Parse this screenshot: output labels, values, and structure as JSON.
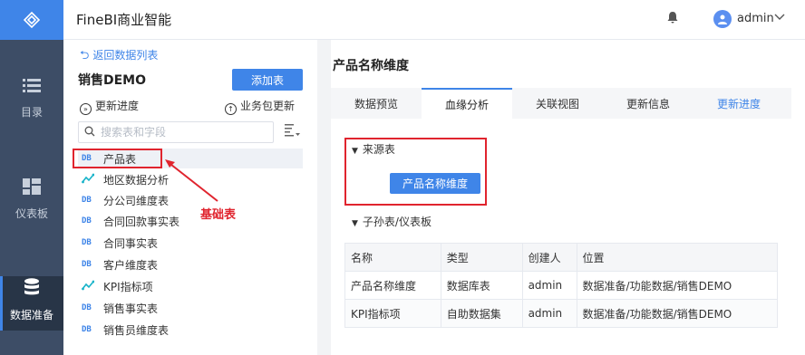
{
  "nav": {
    "items": [
      {
        "label": "目录",
        "icon": "list-icon"
      },
      {
        "label": "仪表板",
        "icon": "dashboard-icon"
      },
      {
        "label": "数据准备",
        "icon": "database-icon"
      }
    ]
  },
  "topbar": {
    "app_title": "FineBI商业智能",
    "username": "admin",
    "avatar": "👤"
  },
  "mid": {
    "back_link": "返回数据列表",
    "package_name": "销售DEMO",
    "add_table_button": "添加表",
    "update_progress": "更新进度",
    "business_update": "业务包更新",
    "search_placeholder": "搜索表和字段",
    "tables": [
      {
        "name": "产品表",
        "type": "DB"
      },
      {
        "name": "地区数据分析",
        "type": "self"
      },
      {
        "name": "分公司维度表",
        "type": "DB"
      },
      {
        "name": "合同回款事实表",
        "type": "DB"
      },
      {
        "name": "合同事实表",
        "type": "DB"
      },
      {
        "name": "客户维度表",
        "type": "DB"
      },
      {
        "name": "KPI指标项",
        "type": "self"
      },
      {
        "name": "销售事实表",
        "type": "DB"
      },
      {
        "name": "销售员维度表",
        "type": "DB"
      }
    ],
    "db_tag": "DB",
    "annotation": "基础表"
  },
  "right": {
    "title": "产品名称维度",
    "tabs": [
      "数据预览",
      "血缘分析",
      "关联视图",
      "更新信息",
      "更新进度"
    ],
    "source_label": "来源表",
    "source_button": "产品名称维度",
    "child_label": "子孙表/仪表板",
    "table": {
      "headers": [
        "名称",
        "类型",
        "创建人",
        "位置"
      ],
      "rows": [
        [
          "产品名称维度",
          "数据库表",
          "admin",
          "数据准备/功能数据/销售DEMO"
        ],
        [
          "KPI指标项",
          "自助数据集",
          "admin",
          "数据准备/功能数据/销售DEMO"
        ]
      ]
    }
  },
  "colors": {
    "accent": "#3f85e8",
    "annotation_red": "#e0242e",
    "nav_bg": "#3d4d66"
  }
}
